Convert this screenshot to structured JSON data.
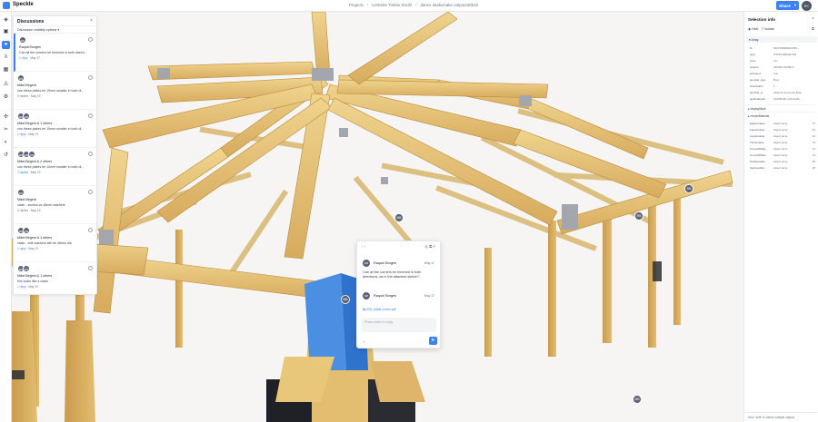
{
  "app": {
    "brand": "Speckle"
  },
  "breadcrumb": [
    "Projects",
    "Lerlenke Timber Roofs",
    "dance studio/cake output230516"
  ],
  "header": {
    "share_label": "Share",
    "user_initials": "RC"
  },
  "rail": {
    "icons": [
      "layers-icon",
      "cube-icon",
      "chat-icon",
      "list-icon",
      "grid-icon",
      "measure-icon",
      "settings-icon",
      "explode-icon",
      "scissors-icon",
      "palette-icon",
      "history-icon"
    ]
  },
  "discussions": {
    "title": "Discussions",
    "visibility_label": "Discussion visibility options",
    "threads": [
      {
        "initials": [
          "RB"
        ],
        "author": "Raquel Borges",
        "text": "Can all the corners be trimmed in both directi...",
        "replies": "1 reply",
        "date": "May 17"
      },
      {
        "initials": [
          "MB"
        ],
        "author": "Mikel Begent",
        "text": "can these plates be 10mm smaller in both di...",
        "replies": "0 replies",
        "date": "May 19"
      },
      {
        "initials": [
          "MB",
          "RB"
        ],
        "author": "Mikel Begent & 1 others",
        "text": "can these plates be 10mm smaller in both di...",
        "replies": "1 reply",
        "date": "May 19"
      },
      {
        "initials": [
          "MB",
          "RB",
          "RB"
        ],
        "author": "Mikel Begent & 2 others",
        "text": "can these plates be 10mm smaller in both di...",
        "replies": "2 replies",
        "date": "May 19"
      },
      {
        "initials": [
          "MB"
        ],
        "author": "Mikel Begent",
        "text": "clash - screws vs 48mm washers",
        "replies": "0 replies",
        "date": "May 19"
      },
      {
        "initials": [
          "MB",
          "RB"
        ],
        "author": "Mikel Begent & 1 others",
        "text": "clash - bolt washers still be 48mm dia",
        "replies": "1 reply",
        "date": "May 19"
      },
      {
        "initials": [
          "MB",
          "RB"
        ],
        "author": "Mikel Begent & 1 others",
        "text": "this looks like a clash",
        "replies": "1 reply",
        "date": "May 19"
      }
    ]
  },
  "popup": {
    "comments": [
      {
        "initials": "RB",
        "author": "Raquel Borges",
        "date": "May 17",
        "text": "Can all the corners be trimmed in both directions, as in the attached sketch?"
      },
      {
        "initials": "RB",
        "author": "Raquel Borges",
        "date": "May 17",
        "attachment": "K05_blade corner.pdf"
      }
    ],
    "input_placeholder": "Press enter to reply"
  },
  "selection": {
    "title": "Selection info",
    "hide_label": "Hide",
    "isolate_label": "Isolate",
    "group_label": "Array",
    "props": [
      {
        "k": "id",
        "v": "8107290968d4254f..."
      },
      {
        "k": "type",
        "v": "bf76574999a07f9d"
      },
      {
        "k": "units",
        "v": "mm"
      },
      {
        "k": "volume",
        "v": "256400.4296974"
      },
      {
        "k": "isClosed",
        "v": "true"
      },
      {
        "k": "speckle_type",
        "v": "Brep"
      },
      {
        "k": "Orientation",
        "v": "1"
      },
      {
        "k": "speckle_ty...",
        "v": "Objects.Geometry.Brep"
      },
      {
        "k": "applicationId",
        "v": "3a338b38-cc49-4a3b..."
      }
    ],
    "subgroups": [
      "displayStyle",
      "renderMaterial"
    ],
    "arrays": [
      {
        "k": "Edges/value",
        "v": "object array",
        "c": "72"
      },
      {
        "k": "Faces/value",
        "v": "object array",
        "c": "20"
      },
      {
        "k": "Loops/value",
        "v": "object array",
        "c": "20"
      },
      {
        "k": "Trims/value",
        "v": "object array",
        "c": "72"
      },
      {
        "k": "Curve2D/dat...",
        "v": "object array",
        "c": "72"
      },
      {
        "k": "Curve3D/dat...",
        "v": "object array",
        "c": "72"
      },
      {
        "k": "Surfaces/da...",
        "v": "object array",
        "c": "20"
      },
      {
        "k": "Vertices/dat...",
        "v": "object array",
        "c": "48"
      }
    ],
    "footer": "Hold \"shift\" to select multiple objects"
  },
  "viewer": {
    "pins": [
      {
        "initials": "RB"
      },
      {
        "initials": "MB"
      },
      {
        "initials": "MB"
      },
      {
        "initials": "RB"
      },
      {
        "initials": "MB"
      }
    ]
  },
  "colors": {
    "accent": "#3b82f6",
    "timber": "#e8c77a",
    "timber_dark": "#c79a48",
    "steel": "#4b8fe3"
  }
}
